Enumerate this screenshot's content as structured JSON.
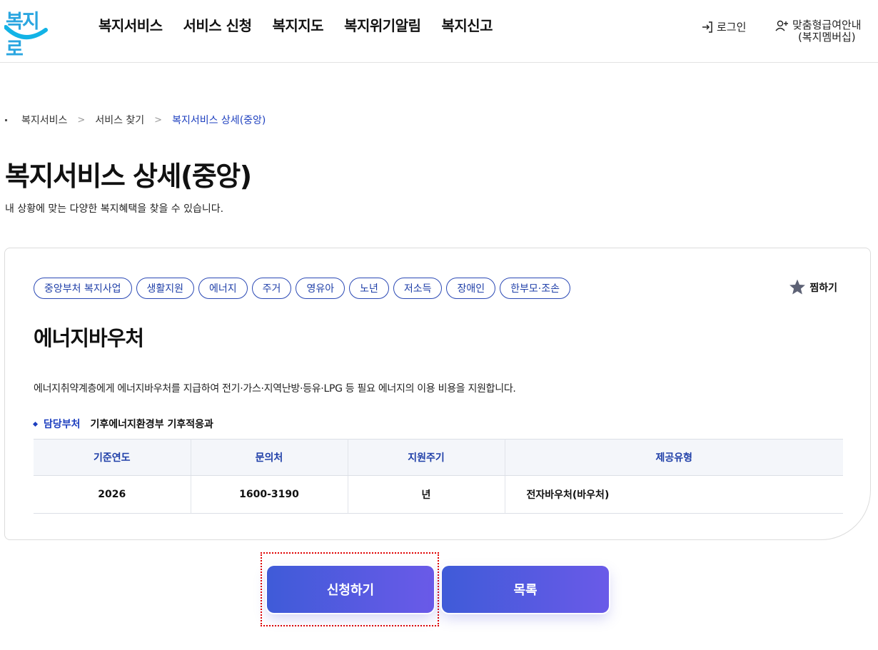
{
  "header": {
    "logo_text": "복지로",
    "nav": [
      "복지서비스",
      "서비스 신청",
      "복지지도",
      "복지위기알림",
      "복지신고"
    ],
    "login_label": "로그인",
    "member_label_1": "맞춤형급여안내",
    "member_label_2": "(복지멤버십)"
  },
  "breadcrumb": [
    "복지서비스",
    "서비스 찾기",
    "복지서비스 상세(중앙)"
  ],
  "page": {
    "title": "복지서비스 상세(중앙)",
    "subtitle": "내 상황에 맞는 다양한 복지혜택을 찾을 수 있습니다."
  },
  "card": {
    "tags": [
      "중앙부처 복지사업",
      "생활지원",
      "에너지",
      "주거",
      "영유아",
      "노년",
      "저소득",
      "장애인",
      "한부모·조손"
    ],
    "favorite_label": "찜하기",
    "service_title": "에너지바우처",
    "description": "에너지취약계층에게 에너지바우처를 지급하여 전기·가스·지역난방·등유·LPG 등 필요 에너지의 이용 비용을 지원합니다.",
    "dept_label": "담당부처",
    "dept_value": "기후에너지환경부 기후적응과",
    "table": {
      "headers": [
        "기준연도",
        "문의처",
        "지원주기",
        "제공유형"
      ],
      "row": [
        "2026",
        "1600-3190",
        "년",
        "전자바우처(바우처)"
      ]
    }
  },
  "buttons": {
    "apply": "신청하기",
    "list": "목록"
  },
  "colors": {
    "brand_blue": "#1d3fbf",
    "button_start": "#3f5bd8",
    "button_end": "#6a5ae8",
    "highlight": "#e00000"
  }
}
